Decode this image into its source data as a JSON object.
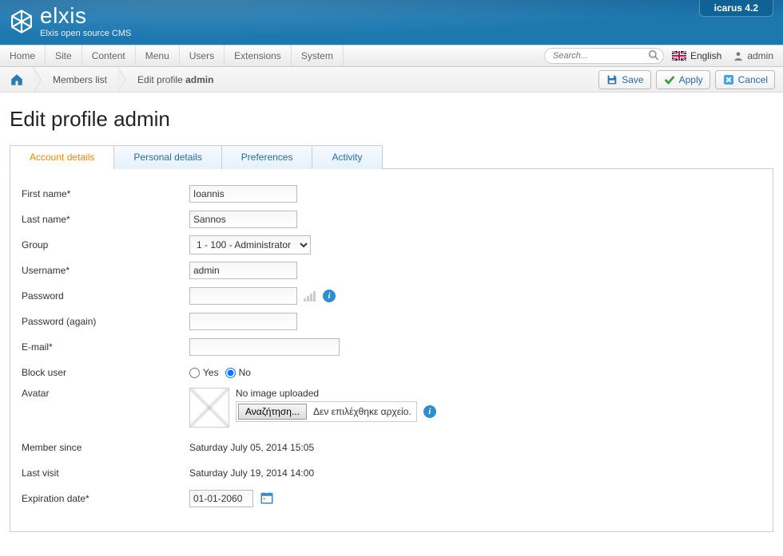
{
  "header": {
    "brand": "elxis",
    "tagline": "Elxis open source CMS",
    "version": "icarus 4.2"
  },
  "menubar": {
    "items": [
      "Home",
      "Site",
      "Content",
      "Menu",
      "Users",
      "Extensions",
      "System"
    ],
    "search_placeholder": "Search...",
    "language": "English",
    "user": "admin"
  },
  "breadcrumbs": {
    "items": [
      "Members list",
      "Edit profile"
    ],
    "current_strong": "admin"
  },
  "toolbar": {
    "save": "Save",
    "apply": "Apply",
    "cancel": "Cancel"
  },
  "page": {
    "title": "Edit profile admin"
  },
  "tabs": [
    "Account details",
    "Personal details",
    "Preferences",
    "Activity"
  ],
  "form": {
    "labels": {
      "firstname": "First name*",
      "lastname": "Last name*",
      "group": "Group",
      "username": "Username*",
      "password": "Password",
      "password2": "Password (again)",
      "email": "E-mail*",
      "block": "Block user",
      "avatar": "Avatar",
      "membersince": "Member since",
      "lastvisit": "Last visit",
      "expiration": "Expiration date*"
    },
    "values": {
      "firstname": "Ioannis",
      "lastname": "Sannos",
      "group_selected": "1 - 100 - Administrator",
      "username": "admin",
      "block_yes": "Yes",
      "block_no": "No",
      "avatar_status": "No image uploaded",
      "file_button": "Αναζήτηση...",
      "file_status": "Δεν επιλέχθηκε αρχείο.",
      "membersince": "Saturday July 05, 2014 15:05",
      "lastvisit": "Saturday July 19, 2014 14:00",
      "expiration": "01-01-2060"
    }
  }
}
